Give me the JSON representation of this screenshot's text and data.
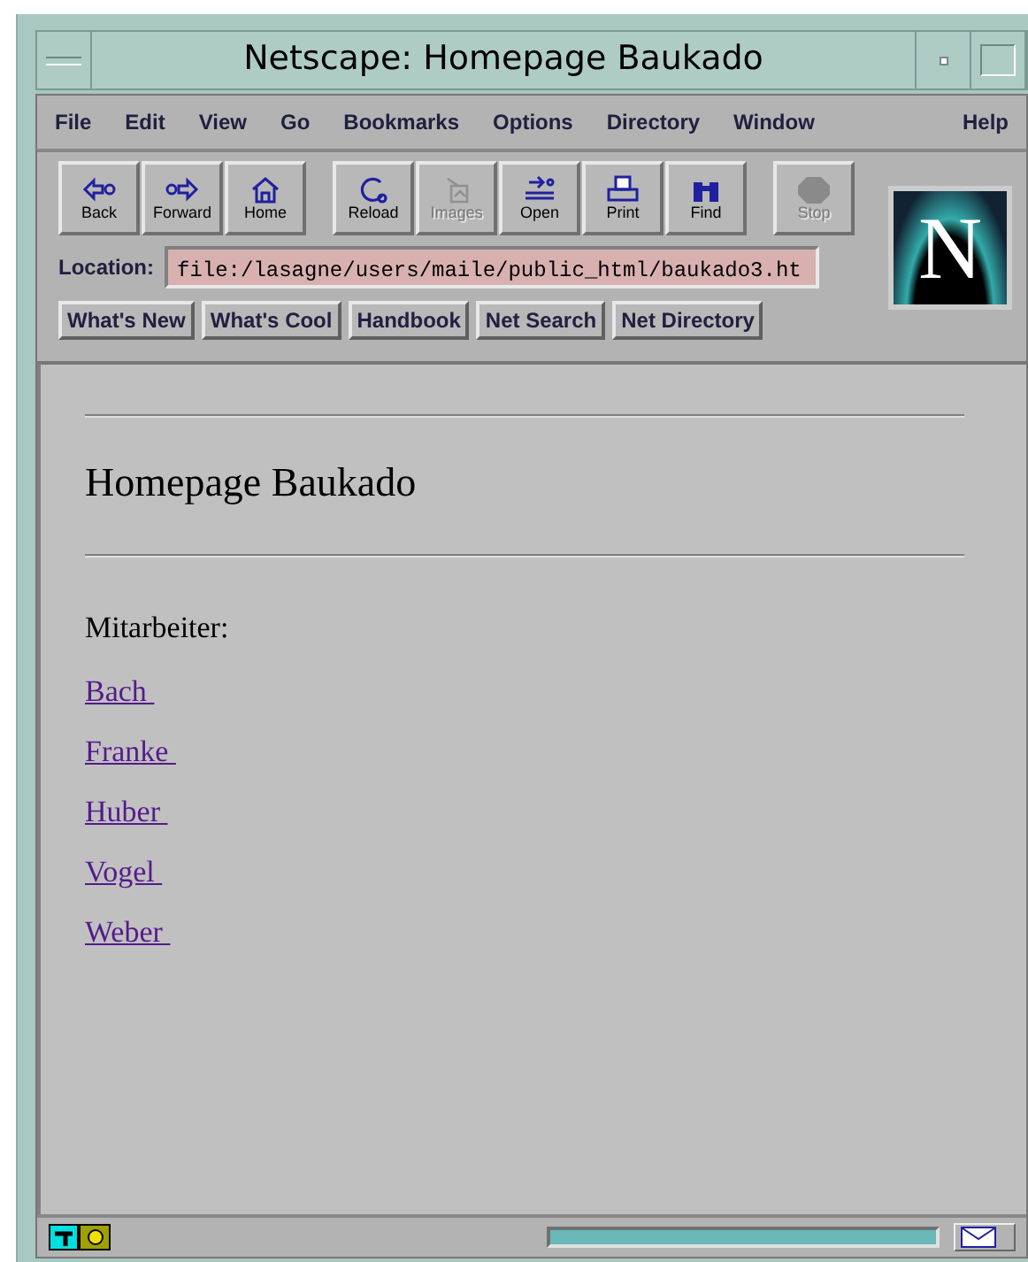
{
  "window": {
    "title": "Netscape: Homepage Baukado"
  },
  "menu": [
    "File",
    "Edit",
    "View",
    "Go",
    "Bookmarks",
    "Options",
    "Directory",
    "Window",
    "Help"
  ],
  "toolbar": [
    {
      "label": "Back",
      "kind": "back",
      "disabled": false
    },
    {
      "label": "Forward",
      "kind": "forward",
      "disabled": false
    },
    {
      "label": "Home",
      "kind": "home",
      "disabled": false
    },
    {
      "label": "Reload",
      "kind": "reload",
      "disabled": false
    },
    {
      "label": "Images",
      "kind": "images",
      "disabled": true
    },
    {
      "label": "Open",
      "kind": "open",
      "disabled": false
    },
    {
      "label": "Print",
      "kind": "print",
      "disabled": false
    },
    {
      "label": "Find",
      "kind": "find",
      "disabled": false
    },
    {
      "label": "Stop",
      "kind": "stop",
      "disabled": true
    }
  ],
  "logo": "N",
  "location": {
    "label": "Location:",
    "value": "file:/lasagne/users/maile/public_html/baukado3.ht"
  },
  "directory_buttons": [
    "What's New",
    "What's Cool",
    "Handbook",
    "Net Search",
    "Net Directory"
  ],
  "page": {
    "heading": "Homepage Baukado",
    "subheading": "Mitarbeiter:",
    "links": [
      "Bach ",
      "Franke ",
      "Huber ",
      "Vogel ",
      "Weber "
    ]
  }
}
